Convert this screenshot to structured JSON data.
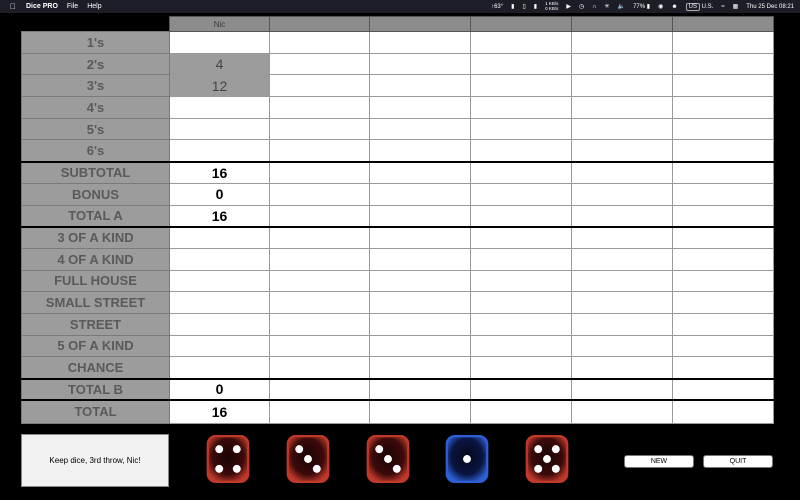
{
  "menubar": {
    "app_name": "Dice PRO",
    "menus": [
      "File",
      "Help"
    ],
    "tray": {
      "temp": "63°",
      "net_up": "1 KB/s",
      "net_down": "0 KB/s",
      "battery": "77%",
      "input_source": "US",
      "input_label": "U.S.",
      "clock": "Thu 25 Dec  08:21"
    }
  },
  "scoreboard": {
    "players": [
      "Nic",
      "",
      "",
      "",
      "",
      ""
    ],
    "rows": [
      {
        "label": "1's",
        "values": [
          "",
          "",
          "",
          "",
          "",
          ""
        ]
      },
      {
        "label": "2's",
        "values": [
          "4",
          "",
          "",
          "",
          "",
          ""
        ],
        "locked": true
      },
      {
        "label": "3's",
        "values": [
          "12",
          "",
          "",
          "",
          "",
          ""
        ],
        "locked": true
      },
      {
        "label": "4's",
        "values": [
          "",
          "",
          "",
          "",
          "",
          ""
        ]
      },
      {
        "label": "5's",
        "values": [
          "",
          "",
          "",
          "",
          "",
          ""
        ]
      },
      {
        "label": "6's",
        "values": [
          "",
          "",
          "",
          "",
          "",
          ""
        ]
      },
      {
        "label": "SUBTOTAL",
        "values": [
          "16",
          "",
          "",
          "",
          "",
          ""
        ],
        "sep": true
      },
      {
        "label": "BONUS",
        "values": [
          "0",
          "",
          "",
          "",
          "",
          ""
        ]
      },
      {
        "label": "TOTAL A",
        "values": [
          "16",
          "",
          "",
          "",
          "",
          ""
        ]
      },
      {
        "label": "3 OF A KIND",
        "values": [
          "",
          "",
          "",
          "",
          "",
          ""
        ],
        "sep": true
      },
      {
        "label": "4 OF A KIND",
        "values": [
          "",
          "",
          "",
          "",
          "",
          ""
        ]
      },
      {
        "label": "FULL HOUSE",
        "values": [
          "",
          "",
          "",
          "",
          "",
          ""
        ]
      },
      {
        "label": "SMALL STREET",
        "values": [
          "",
          "",
          "",
          "",
          "",
          ""
        ]
      },
      {
        "label": "STREET",
        "values": [
          "",
          "",
          "",
          "",
          "",
          ""
        ]
      },
      {
        "label": "5 OF A KIND",
        "values": [
          "",
          "",
          "",
          "",
          "",
          ""
        ]
      },
      {
        "label": "CHANCE",
        "values": [
          "",
          "",
          "",
          "",
          "",
          ""
        ]
      },
      {
        "label": "TOTAL B",
        "values": [
          "0",
          "",
          "",
          "",
          "",
          ""
        ],
        "sep": true
      },
      {
        "label": "TOTAL",
        "values": [
          "16",
          "",
          "",
          "",
          "",
          ""
        ],
        "sep": true
      }
    ]
  },
  "status_message": "Keep dice, 3rd throw, Nic!",
  "dice": [
    {
      "value": 4,
      "color": "#c0392b",
      "held": false
    },
    {
      "value": 3,
      "color": "#c0392b",
      "held": false
    },
    {
      "value": 3,
      "color": "#c0392b",
      "held": false
    },
    {
      "value": 1,
      "color": "#2d5fd6",
      "held": true
    },
    {
      "value": 5,
      "color": "#c0392b",
      "held": false
    }
  ],
  "buttons": {
    "new_label": "NEW",
    "quit_label": "QUIT"
  }
}
